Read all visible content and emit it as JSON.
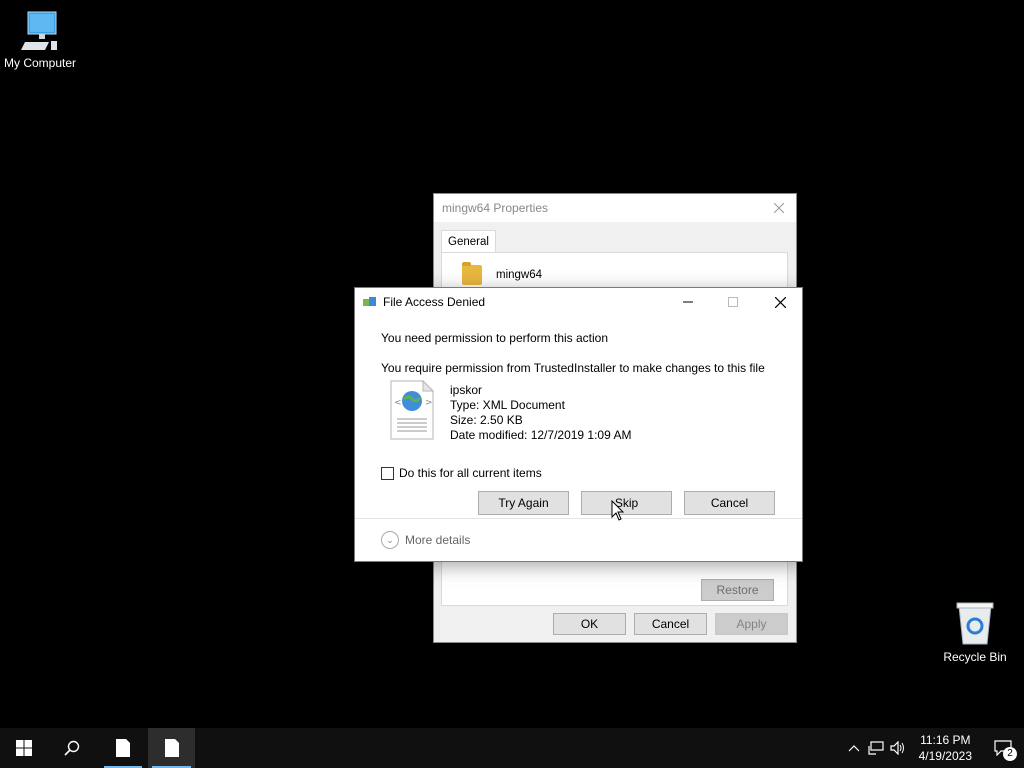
{
  "desktop": {
    "my_computer": "My Computer",
    "recycle_bin": "Recycle Bin"
  },
  "properties": {
    "title": "mingw64 Properties",
    "tab_general": "General",
    "folder_name": "mingw64",
    "restore": "Restore",
    "ok": "OK",
    "cancel": "Cancel",
    "apply": "Apply"
  },
  "dialog": {
    "title": "File Access Denied",
    "message": "You need permission to perform this action",
    "detail": "You require permission from TrustedInstaller to make changes to this file",
    "file": {
      "name": "ipskor",
      "type": "Type: XML Document",
      "size": "Size: 2.50 KB",
      "modified": "Date modified: 12/7/2019 1:09 AM"
    },
    "checkbox_label": "Do this for all current items",
    "try_again": "Try Again",
    "skip": "Skip",
    "cancel": "Cancel",
    "more_details": "More details"
  },
  "taskbar": {
    "time": "11:16 PM",
    "date": "4/19/2023",
    "notification_count": "2",
    "accent": "#76b9ed"
  }
}
